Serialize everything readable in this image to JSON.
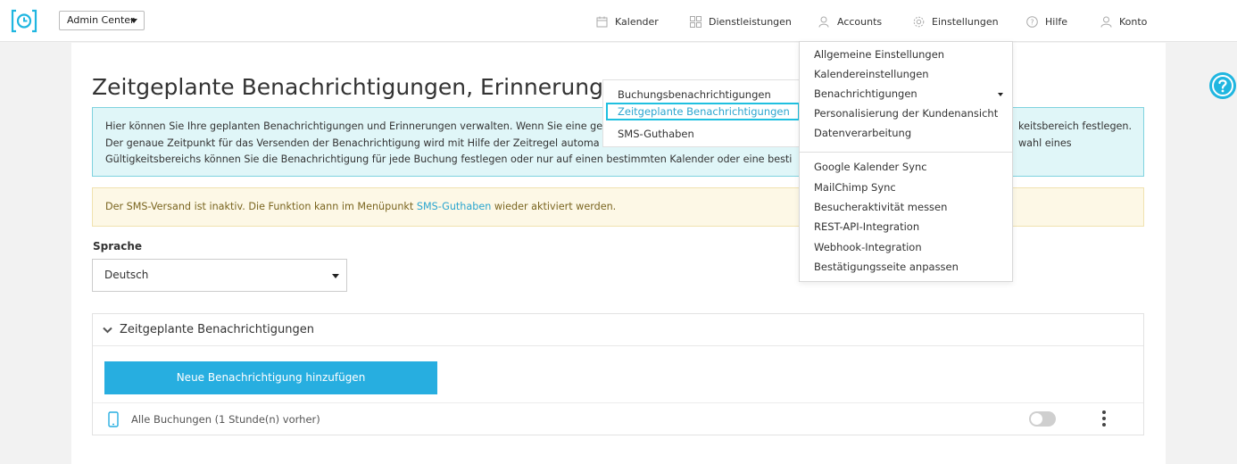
{
  "header": {
    "admin_select": "Admin Center",
    "nav": [
      {
        "label": "Kalender",
        "icon": "calendar-icon"
      },
      {
        "label": "Dienstleistungen",
        "icon": "grid-icon"
      },
      {
        "label": "Accounts",
        "icon": "users-icon"
      },
      {
        "label": "Einstellungen",
        "icon": "gear-icon"
      },
      {
        "label": "Hilfe",
        "icon": "help-icon"
      },
      {
        "label": "Konto",
        "icon": "user-icon"
      }
    ]
  },
  "page": {
    "title": "Zeitgeplante Benachrichtigungen, Erinnerung",
    "info_lines": [
      "Hier können Sie Ihre geplanten Benachrichtigungen und Erinnerungen verwalten. Wenn Sie eine ge",
      "keitsbereich festlegen.",
      "Der genaue Zeitpunkt für das Versenden der Benachrichtigung wird mit Hilfe der Zeitregel automa",
      "wahl eines",
      "Gültigkeitsbereichs können Sie die Benachrichtigung für jede Buchung festlegen oder nur auf einen bestimmten Kalender oder eine besti"
    ],
    "warning_before": "Der SMS-Versand ist inaktiv. Die Funktion kann im Menüpunkt ",
    "warning_link": "SMS-Guthaben",
    "warning_after": " wieder aktiviert werden.",
    "language_label": "Sprache",
    "language_value": "Deutsch"
  },
  "accordion": {
    "title": "Zeitgeplante Benachrichtigungen",
    "add_button": "Neue Benachrichtigung hinzufügen",
    "rows": [
      {
        "label": "Alle Buchungen (1 Stunde(n) vorher)",
        "enabled": false
      }
    ]
  },
  "settings_menu": {
    "group1": [
      "Allgemeine Einstellungen",
      "Kalendereinstellungen",
      "Benachrichtigungen",
      "Personalisierung der Kundenansicht",
      "Datenverarbeitung"
    ],
    "group2": [
      "Google Kalender Sync",
      "MailChimp Sync",
      "Besucheraktivität messen",
      "REST-API-Integration",
      "Webhook-Integration",
      "Bestätigungsseite anpassen"
    ]
  },
  "notifications_submenu": {
    "items": [
      "Buchungsbenachrichtigungen",
      "Zeitgeplante Benachrichtigungen",
      "SMS-Guthaben"
    ],
    "active_index": 1
  },
  "colors": {
    "accent": "#27aee0",
    "brand": "#1fb6e0",
    "info_bg": "#e0f6f8",
    "warning_bg": "#fdf8e6"
  }
}
